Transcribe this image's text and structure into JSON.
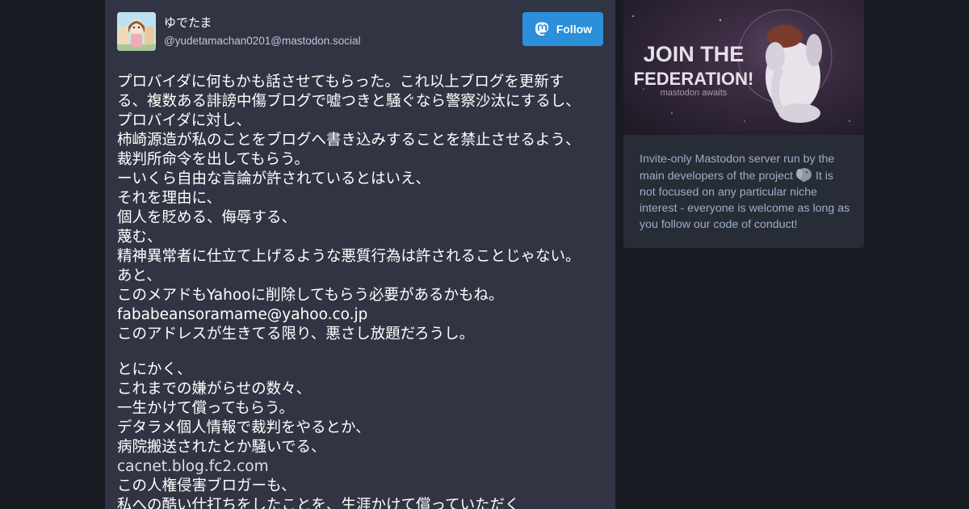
{
  "status": {
    "display_name": "ゆでたま",
    "acct": "@yudetamachan0201@mastodon.social",
    "follow_label": "Follow",
    "paragraphs": [
      [
        "プロバイダに何もかも話させてもらった。これ以上ブログを更新す",
        "る、複数ある誹謗中傷ブログで嘘つきと騒ぐなら警察沙汰にするし、",
        "プロバイダに対し、",
        "柿崎源造が私のことをブログへ書き込みすることを禁止させるよう、",
        "裁判所命令を出してもらう。",
        "ーいくら自由な言論が許されているとはいえ、",
        "それを理由に、",
        "個人を貶める、侮辱する、",
        "蔑む、",
        "精神異常者に仕立て上げるような悪質行為は許されることじゃない。",
        "あと、",
        "このメアドもYahooに削除してもらう必要があるかもね。",
        "fababeansoramame@yahoo.co.jp",
        "このアドレスが生きてる限り、悪さし放題だろうし。"
      ],
      [
        "とにかく、",
        "これまでの嫌がらせの数々、",
        "一生かけて償ってもらう。",
        "デタラメ個人情報で裁判をやるとか、",
        "病院搬送されたとか騒いでる、",
        "cacnet.blog.fc2.com",
        "この人権侵害ブロガーも、",
        "私への酷い仕打ちをしたことを、生涯かけて償っていただく"
      ]
    ]
  },
  "banner": {
    "headline_1": "JOIN THE",
    "headline_2": "FEDERATION!",
    "tagline": "mastodon awaits"
  },
  "about": {
    "text_before_icon": "Invite-only Mastodon server run by the main developers of the project ",
    "icon": "elephant-emoji",
    "text_after_icon": " It is not focused on any particular niche interest - everyone is welcome as long as you follow our code of conduct!"
  },
  "colors": {
    "background": "#191b22",
    "card": "#313543",
    "accent": "#2b90d9",
    "about_panel": "#282c37",
    "muted_text": "#9baec8"
  }
}
